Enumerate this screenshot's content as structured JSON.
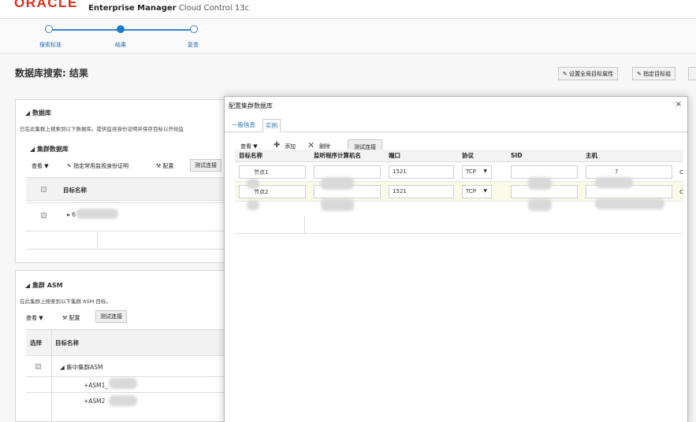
{
  "header": {
    "logo": "ORACLE",
    "product_bold": "Enterprise Manager",
    "product_rest": "Cloud Control 13c"
  },
  "train": {
    "steps": [
      "搜索标准",
      "结果",
      "复查"
    ]
  },
  "page": {
    "title": "数据库搜索: 结果",
    "toolbar": [
      "设置全局目标属性",
      "指定目标组"
    ]
  },
  "db_section": {
    "title": "数据库",
    "desc": "已在此集群上搜索到以下数据库。提供监视身份证明并保存目标以开始监",
    "cluster_db": {
      "title": "集群数据库",
      "view": "查看",
      "specify_cred": "指定常用监视身份证明",
      "configure": "配置",
      "test": "测试连接",
      "col_target": "目标名称",
      "row_prefix": "▸ 6"
    }
  },
  "asm_section": {
    "title": "集群 ASM",
    "desc": "在此集群上搜索到以下集群 ASM 目标。",
    "view": "查看",
    "configure": "配置",
    "test": "测试连接",
    "col_select": "选择",
    "col_target": "目标名称",
    "rows": [
      "集中集群ASM",
      "+ASM1_",
      "+ASM2"
    ]
  },
  "dialog": {
    "title": "配置集群数据库",
    "close": "×",
    "tabs": [
      "一般信息",
      "实例"
    ],
    "toolbar": {
      "view": "查看 ▼",
      "add": "添加",
      "delete": "删除",
      "test": "测试连接"
    },
    "columns": [
      "目标名称",
      "监听程序计算机名",
      "端口",
      "协议",
      "SID",
      "主机"
    ],
    "rows": [
      {
        "target": "节点1",
        "port": "1521",
        "protocol": "TCP",
        "host_suffix": "7",
        "trail": "C"
      },
      {
        "target": "节点2",
        "port": "1521",
        "protocol": "TCP",
        "host_suffix": "",
        "trail": "C"
      }
    ]
  },
  "colors": {
    "accent": "#1a7acb",
    "brand": "#e02a1c"
  }
}
